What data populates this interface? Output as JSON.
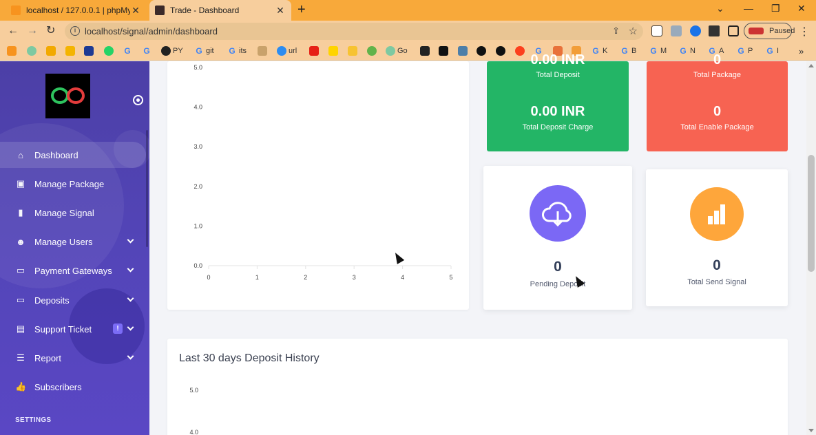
{
  "browser": {
    "tabs": [
      {
        "title": "localhost / 127.0.0.1 | phpMyAdmin",
        "active": false
      },
      {
        "title": "Trade - Dashboard",
        "active": true
      }
    ],
    "url": "localhost/signal/admin/dashboard",
    "profile_status": "Paused",
    "bookmarks": [
      "PY",
      "git",
      "its",
      "url",
      "Go",
      "K",
      "B",
      "M",
      "N",
      "A",
      "P",
      "I"
    ]
  },
  "sidebar": {
    "items": [
      {
        "label": "Dashboard",
        "icon": "home-icon",
        "active": true,
        "expandable": false
      },
      {
        "label": "Manage Package",
        "icon": "package-icon",
        "active": false,
        "expandable": false
      },
      {
        "label": "Manage Signal",
        "icon": "signal-bars-icon",
        "active": false,
        "expandable": false
      },
      {
        "label": "Manage Users",
        "icon": "users-icon",
        "active": false,
        "expandable": true
      },
      {
        "label": "Payment Gateways",
        "icon": "credit-card-icon",
        "active": false,
        "expandable": true
      },
      {
        "label": "Deposits",
        "icon": "wallet-icon",
        "active": false,
        "expandable": true
      },
      {
        "label": "Support Ticket",
        "icon": "ticket-icon",
        "active": false,
        "expandable": true,
        "badge": "!"
      },
      {
        "label": "Report",
        "icon": "list-icon",
        "active": false,
        "expandable": true
      },
      {
        "label": "Subscribers",
        "icon": "thumbs-up-icon",
        "active": false,
        "expandable": false
      }
    ],
    "section_label": "SETTINGS"
  },
  "stats": {
    "total_deposit": {
      "value": "0.00 INR",
      "label": "Total Deposit"
    },
    "total_deposit_charge": {
      "value": "0.00 INR",
      "label": "Total Deposit Charge"
    },
    "total_package": {
      "value": "0",
      "label": "Total Package"
    },
    "total_enable_package": {
      "value": "0",
      "label": "Total Enable Package"
    },
    "pending_deposit": {
      "value": "0",
      "label": "Pending Deposit"
    },
    "total_send_signal": {
      "value": "0",
      "label": "Total Send Signal"
    }
  },
  "colors": {
    "green": "#23b566",
    "red": "#f76352",
    "purple": "#7b68f5",
    "orange": "#fea63b",
    "sidebar": "#5345b8"
  },
  "chart_data": [
    {
      "type": "line",
      "title": "",
      "x": [
        0,
        1,
        2,
        3,
        4,
        5
      ],
      "xlim": [
        0,
        5
      ],
      "ylim": [
        0,
        5
      ],
      "yticks": [
        "0.0",
        "1.0",
        "2.0",
        "3.0",
        "4.0",
        "5.0"
      ],
      "xticks": [
        "0",
        "1",
        "2",
        "3",
        "4",
        "5"
      ],
      "series": []
    },
    {
      "type": "line",
      "title": "Last 30 days Deposit History",
      "ylim": [
        0,
        5
      ],
      "yticks": [
        "4.0",
        "5.0"
      ],
      "series": []
    }
  ]
}
